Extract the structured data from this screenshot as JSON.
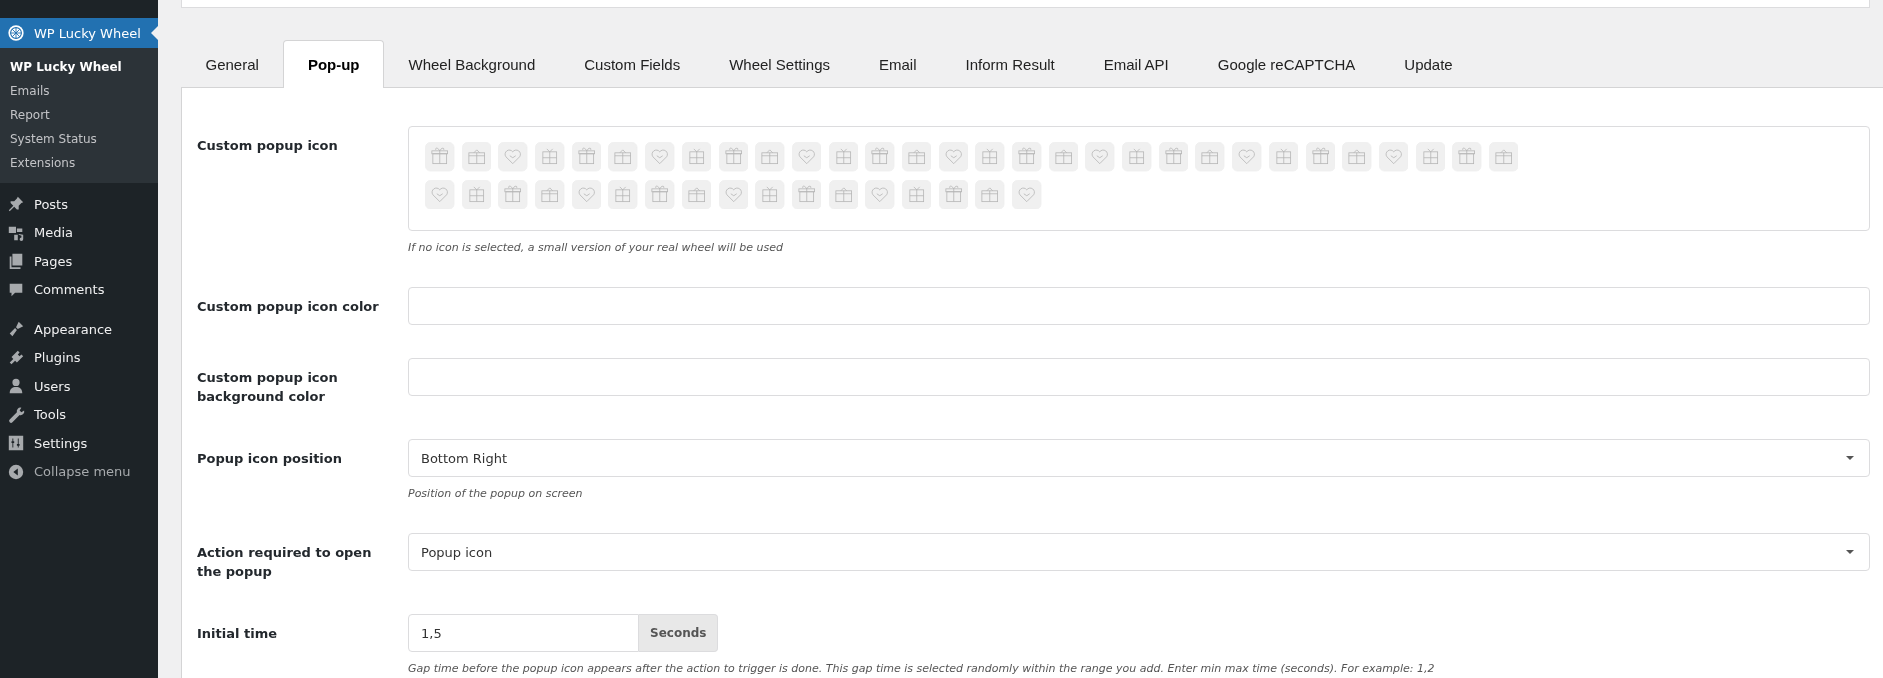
{
  "sidebar": {
    "plugin": {
      "label": "WP Lucky Wheel"
    },
    "submenu": [
      {
        "label": "WP Lucky Wheel",
        "selected": true
      },
      {
        "label": "Emails",
        "selected": false
      },
      {
        "label": "Report",
        "selected": false
      },
      {
        "label": "System Status",
        "selected": false
      },
      {
        "label": "Extensions",
        "selected": false
      }
    ],
    "groups": [
      {
        "items": [
          {
            "label": "Posts",
            "kind": "pin"
          },
          {
            "label": "Media",
            "kind": "media"
          },
          {
            "label": "Pages",
            "kind": "pages"
          },
          {
            "label": "Comments",
            "kind": "comment"
          }
        ]
      },
      {
        "items": [
          {
            "label": "Appearance",
            "kind": "brush"
          },
          {
            "label": "Plugins",
            "kind": "plug"
          },
          {
            "label": "Users",
            "kind": "user"
          },
          {
            "label": "Tools",
            "kind": "wrench"
          },
          {
            "label": "Settings",
            "kind": "sliders"
          },
          {
            "label": "Collapse menu",
            "kind": "collapse"
          }
        ]
      }
    ]
  },
  "tabs": [
    {
      "label": "General",
      "selected": false
    },
    {
      "label": "Pop-up",
      "selected": true
    },
    {
      "label": "Wheel Background",
      "selected": false
    },
    {
      "label": "Custom Fields",
      "selected": false
    },
    {
      "label": "Wheel Settings",
      "selected": false
    },
    {
      "label": "Email",
      "selected": false
    },
    {
      "label": "Inform Result",
      "selected": false
    },
    {
      "label": "Email API",
      "selected": false
    },
    {
      "label": "Google reCAPTCHA",
      "selected": false
    },
    {
      "label": "Update",
      "selected": false
    }
  ],
  "form": [
    {
      "kind": "icons",
      "label": "Custom popup icon",
      "note": "If no icon is selected, a small version of your real wheel will be used",
      "icon_options": [
        {
          "selected": false
        },
        {
          "selected": false
        },
        {
          "selected": false
        },
        {
          "selected": false
        },
        {
          "selected": false
        },
        {
          "selected": false
        },
        {
          "selected": false
        },
        {
          "selected": false
        },
        {
          "selected": false
        },
        {
          "selected": false
        },
        {
          "selected": false
        },
        {
          "selected": false
        },
        {
          "selected": false
        },
        {
          "selected": false
        },
        {
          "selected": false
        },
        {
          "selected": false
        },
        {
          "selected": false
        },
        {
          "selected": false
        },
        {
          "selected": false
        },
        {
          "selected": false
        },
        {
          "selected": false
        },
        {
          "selected": false
        },
        {
          "selected": false
        },
        {
          "selected": false
        },
        {
          "selected": false
        },
        {
          "selected": false
        },
        {
          "selected": false
        },
        {
          "selected": false
        },
        {
          "selected": false
        },
        {
          "selected": false
        },
        {
          "selected": false
        },
        {
          "selected": false
        },
        {
          "selected": false
        },
        {
          "selected": false
        },
        {
          "selected": false
        },
        {
          "selected": false
        },
        {
          "selected": false
        },
        {
          "selected": false
        },
        {
          "selected": false
        },
        {
          "selected": false
        },
        {
          "selected": false
        },
        {
          "selected": false
        },
        {
          "selected": false
        },
        {
          "selected": false
        },
        {
          "selected": false
        },
        {
          "selected": false
        },
        {
          "selected": false
        }
      ]
    },
    {
      "kind": "text",
      "label": "Custom popup icon color"
    },
    {
      "kind": "text",
      "label": "Custom popup icon background color"
    },
    {
      "kind": "select",
      "label": "Popup icon position",
      "value": "Bottom Right",
      "note": "Position of the popup on screen"
    },
    {
      "kind": "select",
      "label": "Action required to open the popup",
      "value": "Popup icon"
    },
    {
      "kind": "addon",
      "label": "Initial time",
      "value": "1,5",
      "addon": "Seconds",
      "note": "Gap time before the popup icon appears after the action to trigger is done. This gap time is selected randomly within the range you add. Enter min max time (seconds). For example: 1,2"
    }
  ]
}
